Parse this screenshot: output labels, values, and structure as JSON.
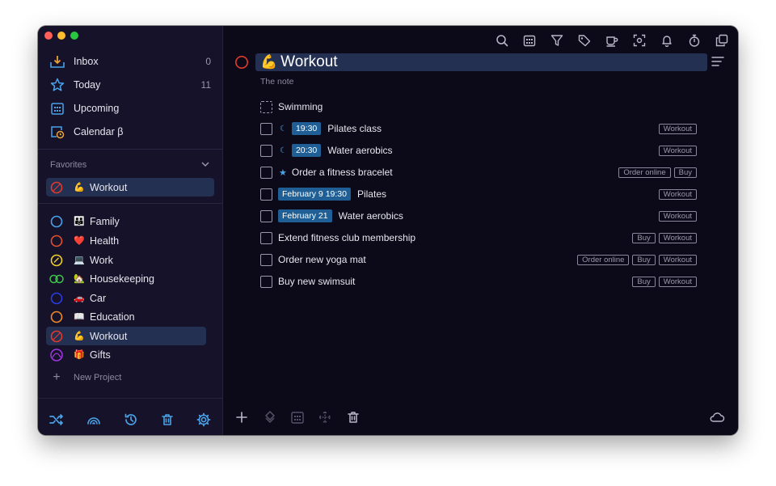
{
  "sidebar": {
    "nav": [
      {
        "label": "Inbox",
        "count": "0",
        "icon": "inbox-icon"
      },
      {
        "label": "Today",
        "count": "11",
        "icon": "star-icon"
      },
      {
        "label": "Upcoming",
        "count": "",
        "icon": "calendar-icon"
      },
      {
        "label": "Calendar β",
        "count": "",
        "icon": "calendar-clock-icon"
      }
    ],
    "favorites_label": "Favorites",
    "favorites": [
      {
        "label": "Workout",
        "emoji": "💪"
      }
    ],
    "projects": [
      {
        "label": "Family",
        "emoji": "👪"
      },
      {
        "label": "Health",
        "emoji": "❤️"
      },
      {
        "label": "Work",
        "emoji": "💻"
      },
      {
        "label": "Housekeeping",
        "emoji": "🏡"
      },
      {
        "label": "Car",
        "emoji": "🚗"
      },
      {
        "label": "Education",
        "emoji": "📖"
      },
      {
        "label": "Workout",
        "emoji": "💪"
      },
      {
        "label": "Gifts",
        "emoji": "🎁"
      }
    ],
    "new_project": "New Project"
  },
  "main": {
    "title_emoji": "💪",
    "title": "Workout",
    "note": "The note",
    "tasks": [
      {
        "text": "Swimming",
        "time": "",
        "tags": []
      },
      {
        "text": "Pilates class",
        "time": "19:30",
        "tags": [
          "Workout"
        ]
      },
      {
        "text": "Water aerobics",
        "time": "20:30",
        "tags": [
          "Workout"
        ]
      },
      {
        "text": "Order a fitness bracelet",
        "time": "",
        "tags": [
          "Order online",
          "Buy"
        ]
      },
      {
        "text": "Pilates",
        "time": "February 9 19:30",
        "tags": [
          "Workout"
        ]
      },
      {
        "text": "Water aerobics",
        "time": "February 21",
        "tags": [
          "Workout"
        ]
      },
      {
        "text": "Extend fitness club membership",
        "time": "",
        "tags": [
          "Buy",
          "Workout"
        ]
      },
      {
        "text": "Order new yoga mat",
        "time": "",
        "tags": [
          "Order online",
          "Buy",
          "Workout"
        ]
      },
      {
        "text": "Buy new swimsuit",
        "time": "",
        "tags": [
          "Buy",
          "Workout"
        ]
      }
    ]
  },
  "colors": {
    "accent": "#4aa3e8",
    "selection": "#233052",
    "badge": "#1f5f95",
    "workout_ring": "#e03a2f"
  }
}
